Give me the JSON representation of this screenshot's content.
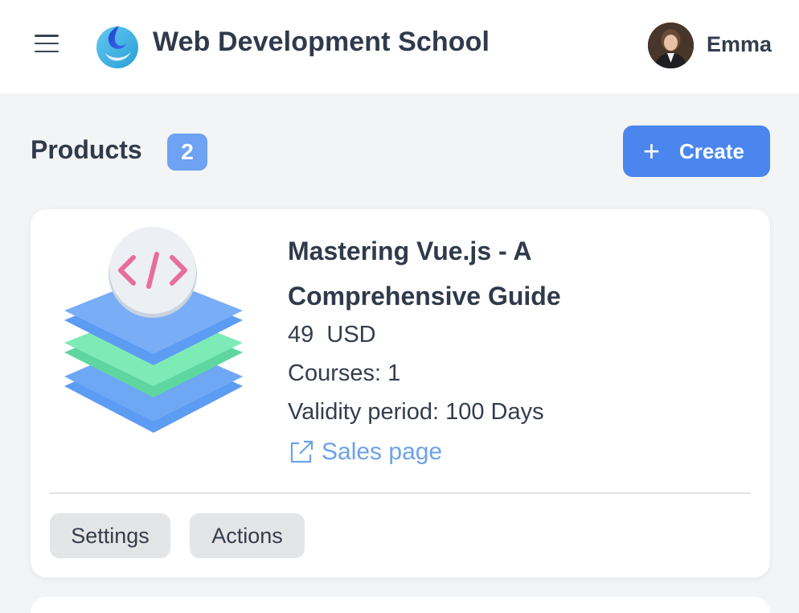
{
  "header": {
    "brand": "Web Development School",
    "user_name": "Emma",
    "menu_icon": "hamburger-icon",
    "logo_icon": "logo-icon"
  },
  "products": {
    "title": "Products",
    "count": "2",
    "create_label": "Create",
    "create_icon": "plus-icon"
  },
  "product": {
    "title": "Mastering Vue.js - A Comprehensive Guide",
    "price": "49  USD",
    "courses": "Courses: 1",
    "validity": "Validity period: 100 Days",
    "sales_link": "Sales page",
    "settings_label": "Settings",
    "actions_label": "Actions",
    "illustration_icon": "layers-code-icon"
  },
  "colors": {
    "accent": "#4a86ee",
    "badge": "#6ea2f2",
    "link": "#6ea2e8"
  }
}
